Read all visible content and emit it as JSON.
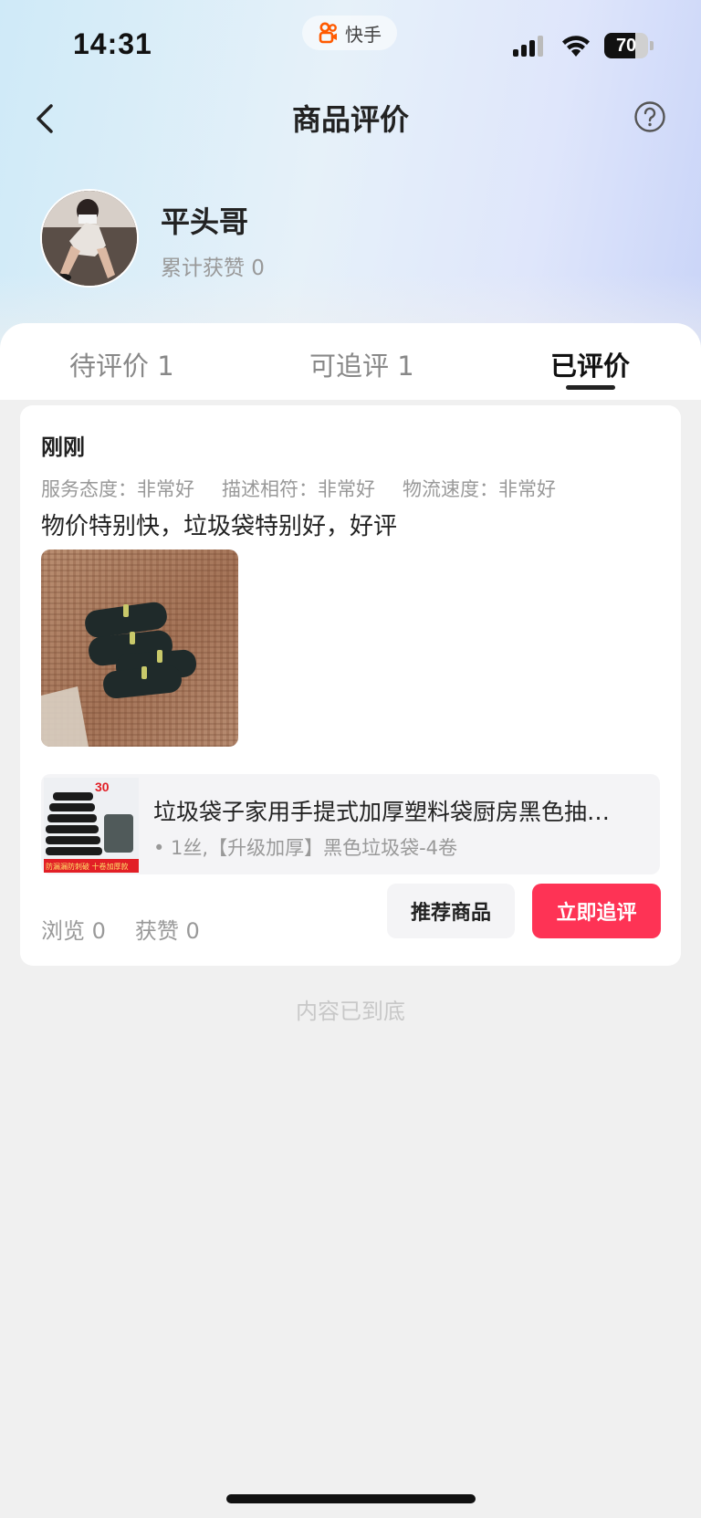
{
  "status_bar": {
    "time": "14:31",
    "app_name": "快手",
    "battery": 70,
    "battery_label": "70"
  },
  "nav": {
    "title": "商品评价",
    "back_icon": "chevron-left-icon",
    "help_icon": "question-circle-icon"
  },
  "profile": {
    "username": "平头哥",
    "likes_total": "累计获赞 0"
  },
  "tabs": [
    {
      "label": "待评价 1",
      "active": false
    },
    {
      "label": "可追评 1",
      "active": false
    },
    {
      "label": "已评价",
      "active": true
    }
  ],
  "review": {
    "time": "刚刚",
    "ratings": [
      "服务态度：非常好",
      "描述相符：非常好",
      "物流速度：非常好"
    ],
    "text": "物价特别快，垃圾袋特别好，好评",
    "product": {
      "name": "垃圾袋子家用手提式加厚塑料袋厨房黑色抽取式大号一次性垃圾袋",
      "variant": "• 1丝,【升级加厚】黑色垃圾袋-4卷",
      "thumb_badge": "30",
      "thumb_caption": "防漏漏防刺破 十卷加厚款"
    },
    "stats": {
      "views": "浏览 0",
      "likes": "获赞 0"
    },
    "buttons": {
      "recommend": "推荐商品",
      "followup": "立即追评"
    }
  },
  "footer": {
    "end_note": "内容已到底"
  },
  "colors": {
    "accent": "#fe3355",
    "logo": "#ff5a00"
  }
}
